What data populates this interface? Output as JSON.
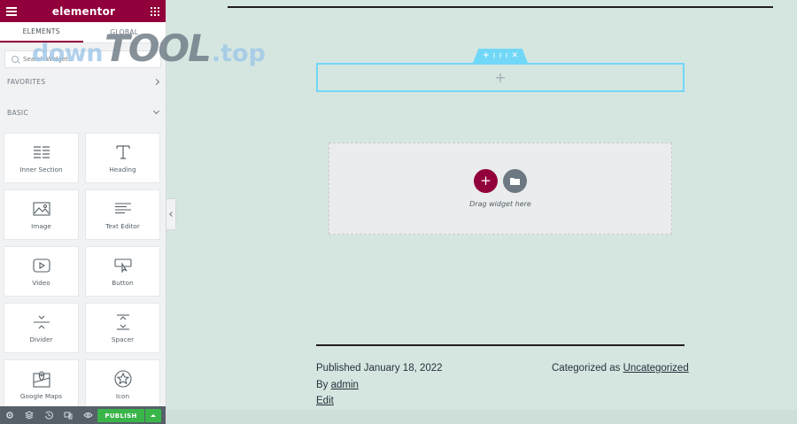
{
  "sidebar": {
    "brand": "elementor",
    "tabs": [
      {
        "label": "ELEMENTS",
        "active": true
      },
      {
        "label": "GLOBAL",
        "active": false
      }
    ],
    "search": {
      "placeholder": "Search Widget...",
      "value": ""
    },
    "categories": {
      "favorites": "FAVORITES",
      "basic": "BASIC"
    },
    "widgets": [
      {
        "label": "Inner Section",
        "icon": "inner-section-icon"
      },
      {
        "label": "Heading",
        "icon": "heading-icon"
      },
      {
        "label": "Image",
        "icon": "image-icon"
      },
      {
        "label": "Text Editor",
        "icon": "text-editor-icon"
      },
      {
        "label": "Video",
        "icon": "video-icon"
      },
      {
        "label": "Button",
        "icon": "button-icon"
      },
      {
        "label": "Divider",
        "icon": "divider-icon"
      },
      {
        "label": "Spacer",
        "icon": "spacer-icon"
      },
      {
        "label": "Google Maps",
        "icon": "google-maps-icon"
      },
      {
        "label": "Icon",
        "icon": "star-icon"
      }
    ],
    "footer": {
      "publish_label": "PUBLISH",
      "icons": [
        "settings-icon",
        "layers-icon",
        "history-icon",
        "responsive-icon",
        "preview-icon"
      ]
    }
  },
  "watermark": {
    "part1": "down",
    "part2": "TOOL",
    "part3": ".top"
  },
  "canvas": {
    "dropzone_text": "Drag widget here",
    "published": "Published January 18, 2022",
    "categorized_prefix": "Categorized as",
    "category": "Uncategorized",
    "by_prefix": "By",
    "author": "admin",
    "edit": "Edit"
  },
  "colors": {
    "brand": "#92003b",
    "accent": "#71d7f7",
    "publish": "#39b54a",
    "canvas_bg": "#d5e6e0"
  }
}
